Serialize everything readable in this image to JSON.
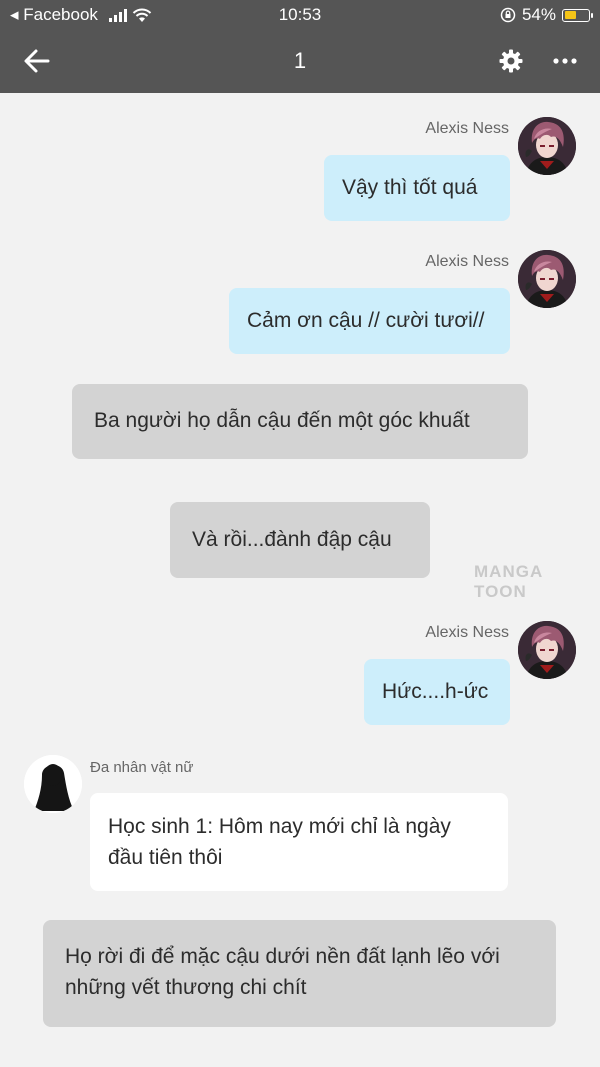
{
  "status": {
    "back_app": "◂ Facebook",
    "time": "10:53",
    "battery": "54%",
    "battery_level": 0.54
  },
  "nav": {
    "title": "1"
  },
  "messages": [
    {
      "sender": "Alexis Ness",
      "text": "Vậy thì tốt quá"
    },
    {
      "sender": "Alexis Ness",
      "text": "Cảm ơn cậu // cười tươi//"
    },
    {
      "text": "Ba người họ dẫn cậu đến một góc khuất"
    },
    {
      "text": "Và rồi...đành đập cậu"
    },
    {
      "sender": "Alexis Ness",
      "text": "Hức....h-ức"
    },
    {
      "sender": "Đa nhân vật nữ",
      "text": "Học sinh 1: Hôm nay mới chỉ là ngày đầu tiên thôi"
    },
    {
      "text": "Họ rời đi để mặc cậu dưới nền đất lạnh lẽo với những vết thương chi chít"
    }
  ],
  "watermark": "MANGA TOON",
  "colors": {
    "header": "#555555",
    "self_bubble": "#cdeefb",
    "narration_bubble": "#d3d3d3",
    "other_bubble": "#ffffff",
    "background": "#f2f2f2"
  },
  "icons": [
    "back-arrow-icon",
    "gear-icon",
    "more-icon",
    "wifi-icon",
    "signal-icon",
    "battery-icon",
    "rotation-lock-icon"
  ]
}
